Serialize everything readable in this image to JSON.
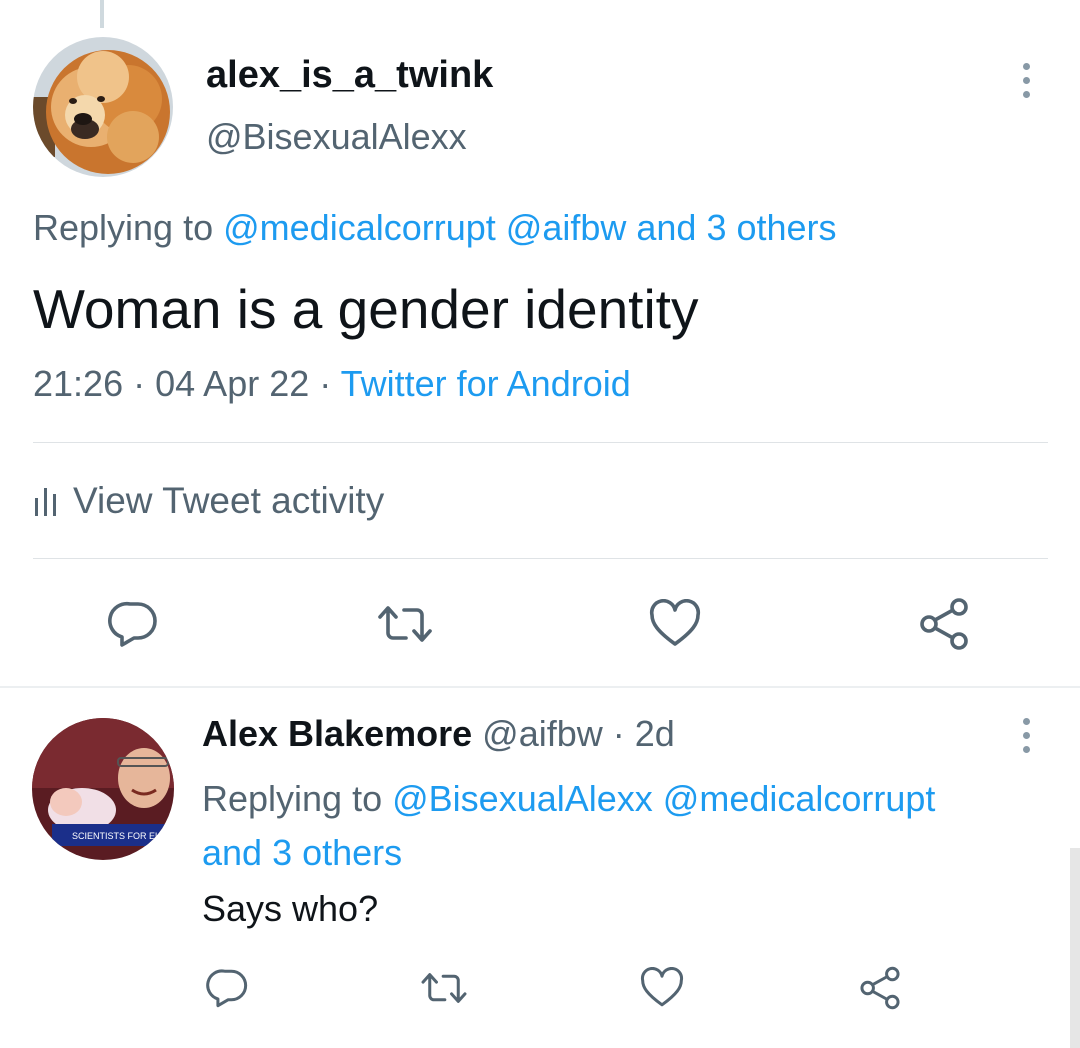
{
  "tweet": {
    "display_name": "alex_is_a_twink",
    "handle": "@BisexualAlexx",
    "replying_prefix": "Replying to",
    "replying_to": [
      "@medicalcorrupt",
      "@aifbw",
      "and 3 others"
    ],
    "text": "Woman is a gender identity",
    "time": "21:26",
    "date": "04 Apr 22",
    "source": "Twitter for Android",
    "meta_separator": "·",
    "activity_label": "View Tweet activity"
  },
  "reply": {
    "display_name": "Alex Blakemore",
    "handle": "@aifbw",
    "separator": "·",
    "age": "2d",
    "replying_prefix": "Replying to",
    "replying_to": [
      "@BisexualAlexx",
      "@medicalcorrupt"
    ],
    "replying_to_more": "and 3 others",
    "text": "Says who?",
    "avatar_banner_text": "SCIENTISTS FOR EU"
  },
  "icons": {
    "reply": "reply-icon",
    "retweet": "retweet-icon",
    "like": "heart-icon",
    "share": "share-icon",
    "more": "more-vertical-icon",
    "activity": "bar-chart-icon"
  },
  "colors": {
    "link": "#1d9bf0",
    "secondary_text": "#536471",
    "primary_text": "#0f1419",
    "icon": "#536471"
  }
}
